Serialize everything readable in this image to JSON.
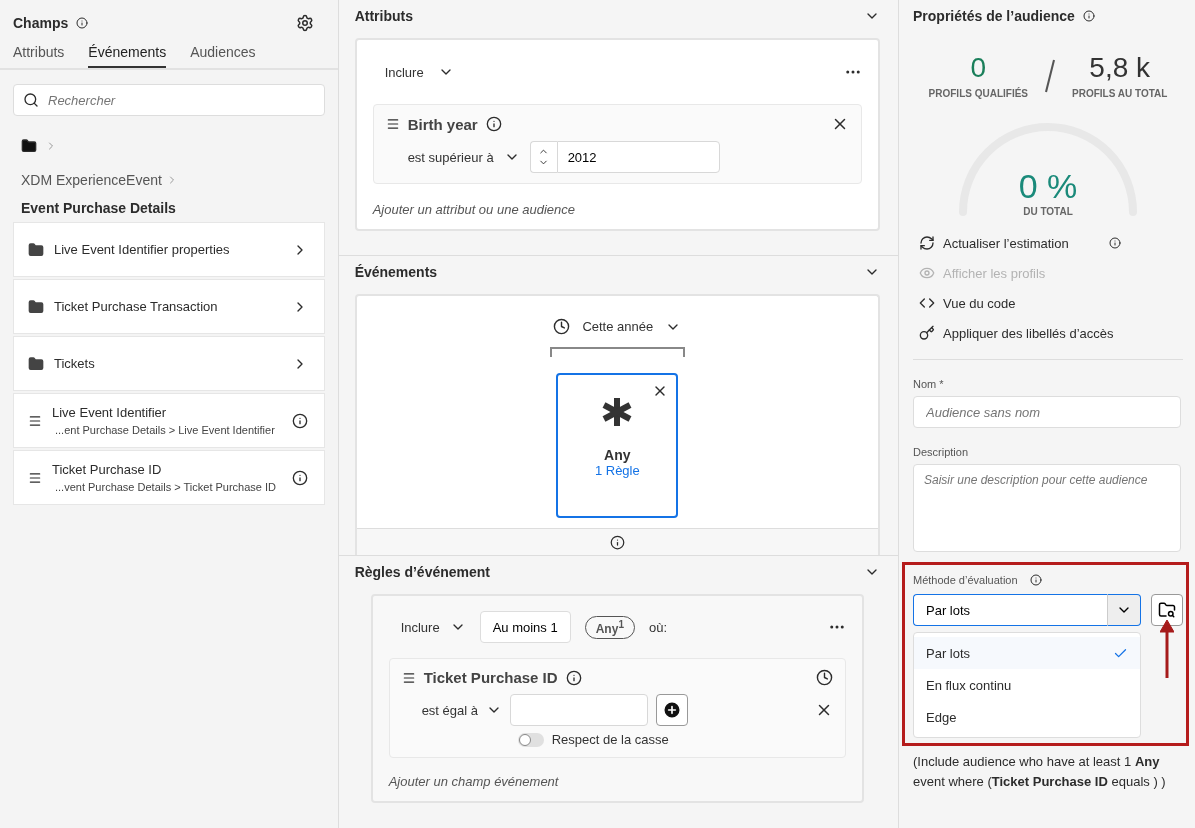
{
  "fields_panel": {
    "title": "Champs",
    "tabs": [
      {
        "label": "Attributs",
        "selected": false
      },
      {
        "label": "Événements",
        "selected": true
      },
      {
        "label": "Audiences",
        "selected": false
      }
    ],
    "search": {
      "placeholder": "Rechercher"
    },
    "breadcrumb": "XDM ExperienceEvent",
    "heading": "Event Purchase Details",
    "items": [
      {
        "kind": "folder",
        "label": "Live Event Identifier properties"
      },
      {
        "kind": "folder",
        "label": "Ticket Purchase Transaction"
      },
      {
        "kind": "folder",
        "label": "Tickets"
      },
      {
        "kind": "field",
        "label": "Live Event Identifier",
        "path": "...ent Purchase Details > Live Event Identifier"
      },
      {
        "kind": "field",
        "label": "Ticket Purchase ID",
        "path": "...vent Purchase Details > Ticket Purchase ID"
      }
    ]
  },
  "attributes": {
    "title": "Attributs",
    "include": "Inclure",
    "rule": {
      "name": "Birth year",
      "operator": "est supérieur à",
      "value": "2012"
    },
    "add_link": "Ajouter un attribut ou une audience"
  },
  "events": {
    "title": "Événements",
    "time": "Cette année",
    "card": {
      "name": "Any",
      "rules": "1 Règle"
    }
  },
  "event_rules": {
    "title": "Règles d’événement",
    "include": "Inclure",
    "count": "Au moins 1",
    "badge": "Any",
    "badge_sup": "1",
    "where": "où:",
    "rule": {
      "name": "Ticket Purchase ID",
      "operator": "est égal à",
      "case_sensitive": false,
      "case_label": "Respect de la casse"
    },
    "add_link": "Ajouter un champ événement"
  },
  "properties": {
    "title": "Propriétés de l’audience",
    "qualified": "0",
    "qualified_label": "PROFILS QUALIFIÉS",
    "total": "5,8 k",
    "total_label": "PROFILS AU TOTAL",
    "gauge": {
      "percent": "0 %",
      "label": "DU TOTAL"
    },
    "actions": [
      {
        "kind": "refresh",
        "label": "Actualiser l’estimation",
        "disabled": false,
        "info": true
      },
      {
        "kind": "eye",
        "label": "Afficher les profils",
        "disabled": true,
        "info": false
      },
      {
        "kind": "code",
        "label": "Vue du code",
        "disabled": false,
        "info": false
      },
      {
        "kind": "key",
        "label": "Appliquer des libellés d’accès",
        "disabled": false,
        "info": false
      }
    ],
    "name": {
      "label": "Nom *",
      "placeholder": "Audience sans nom"
    },
    "description": {
      "label": "Description",
      "placeholder": "Saisir une description pour cette audience"
    },
    "evaluation": {
      "label": "Méthode d’évaluation",
      "value": "Par lots",
      "options": [
        {
          "label": "Par lots",
          "selected": true
        },
        {
          "label": "En flux continu",
          "selected": false
        },
        {
          "label": "Edge",
          "selected": false
        }
      ]
    },
    "summary": [
      "(Include audience who have at least 1 **Any**",
      "event where (**Ticket Purchase ID** equals ) )"
    ]
  }
}
